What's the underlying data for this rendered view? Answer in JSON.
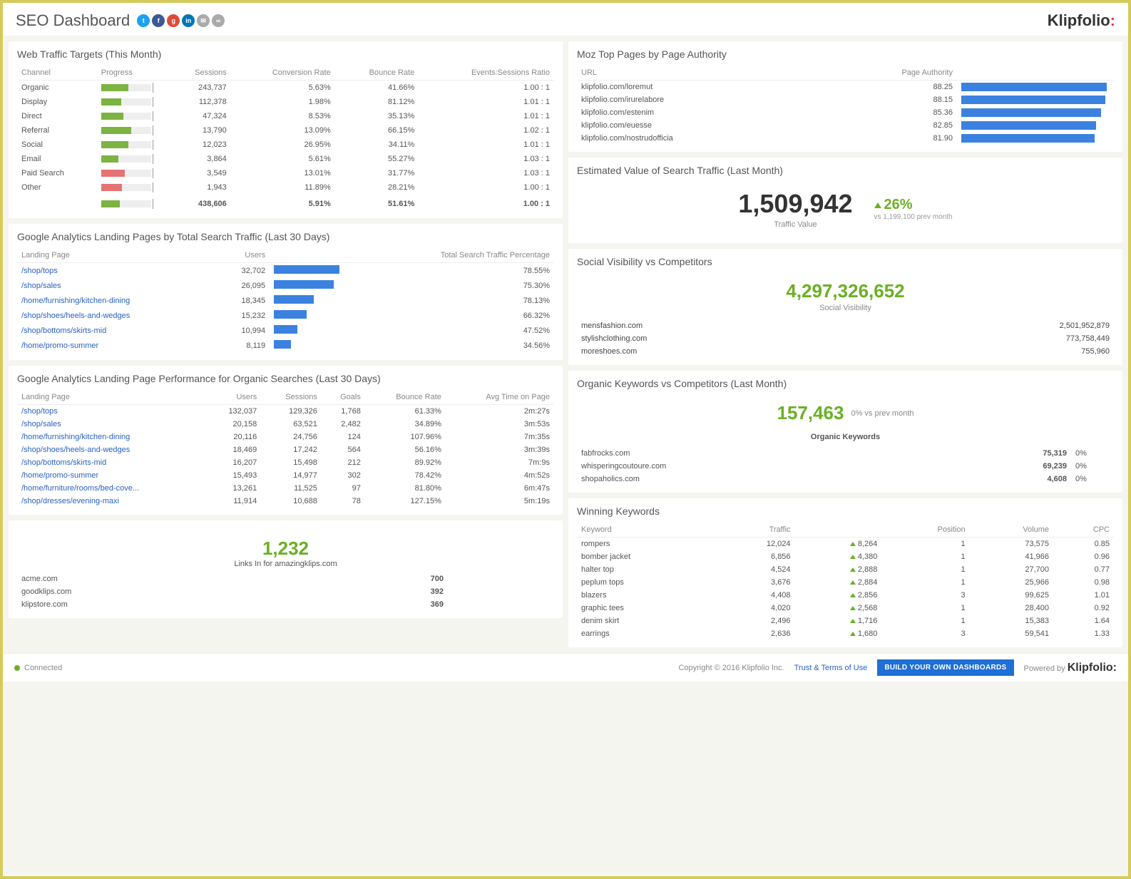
{
  "header": {
    "title": "SEO Dashboard",
    "brand": "Klipfolio",
    "social": [
      "twitter",
      "facebook",
      "gplus",
      "linkedin",
      "mail",
      "link"
    ]
  },
  "trafficTargets": {
    "title": "Web Traffic Targets (This Month)",
    "headers": [
      "Channel",
      "Progress",
      "Sessions",
      "Conversion Rate",
      "Bounce Rate",
      "Events:Sessions Ratio"
    ],
    "rows": [
      {
        "channel": "Organic",
        "progress": 55,
        "color": "#7cb342",
        "sessions": "243,737",
        "conv": "5.63%",
        "bounce": "41.66%",
        "ratio": "1.00 : 1"
      },
      {
        "channel": "Display",
        "progress": 40,
        "color": "#7cb342",
        "sessions": "112,378",
        "conv": "1.98%",
        "bounce": "81.12%",
        "ratio": "1.01 : 1"
      },
      {
        "channel": "Direct",
        "progress": 45,
        "color": "#7cb342",
        "sessions": "47,324",
        "conv": "8.53%",
        "bounce": "35.13%",
        "ratio": "1.01 : 1"
      },
      {
        "channel": "Referral",
        "progress": 60,
        "color": "#7cb342",
        "sessions": "13,790",
        "conv": "13.09%",
        "bounce": "66.15%",
        "ratio": "1.02 : 1"
      },
      {
        "channel": "Social",
        "progress": 55,
        "color": "#7cb342",
        "sessions": "12,023",
        "conv": "26.95%",
        "bounce": "34.11%",
        "ratio": "1.01 : 1"
      },
      {
        "channel": "Email",
        "progress": 35,
        "color": "#7cb342",
        "sessions": "3,864",
        "conv": "5.61%",
        "bounce": "55.27%",
        "ratio": "1.03 : 1"
      },
      {
        "channel": "Paid Search",
        "progress": 48,
        "color": "#e57373",
        "sessions": "3,549",
        "conv": "13.01%",
        "bounce": "31.77%",
        "ratio": "1.03 : 1"
      },
      {
        "channel": "Other",
        "progress": 42,
        "color": "#e57373",
        "sessions": "1,943",
        "conv": "11.89%",
        "bounce": "28.21%",
        "ratio": "1.00 : 1"
      }
    ],
    "totals": {
      "progress": 38,
      "sessions": "438,606",
      "conv": "5.91%",
      "bounce": "51.61%",
      "ratio": "1.00 : 1"
    }
  },
  "landingPages": {
    "title": "Google Analytics Landing Pages by Total Search Traffic (Last 30 Days)",
    "headers": [
      "Landing Page",
      "Users",
      "",
      "Total Search Traffic Percentage"
    ],
    "rows": [
      {
        "page": "/shop/tops",
        "users": "32,702",
        "bar": 85,
        "pct": "78.55%"
      },
      {
        "page": "/shop/sales",
        "users": "26,095",
        "bar": 78,
        "pct": "75.30%"
      },
      {
        "page": "/home/furnishing/kitchen-dining",
        "users": "18,345",
        "bar": 52,
        "pct": "78.13%"
      },
      {
        "page": "/shop/shoes/heels-and-wedges",
        "users": "15,232",
        "bar": 42,
        "pct": "66.32%"
      },
      {
        "page": "/shop/bottoms/skirts-mid",
        "users": "10,994",
        "bar": 30,
        "pct": "47.52%"
      },
      {
        "page": "/home/promo-summer",
        "users": "8,119",
        "bar": 22,
        "pct": "34.56%"
      }
    ]
  },
  "landingPerf": {
    "title": "Google Analytics Landing Page Performance for Organic Searches (Last 30 Days)",
    "headers": [
      "Landing Page",
      "Users",
      "Sessions",
      "Goals",
      "Bounce Rate",
      "Avg Time on Page"
    ],
    "rows": [
      {
        "page": "/shop/tops",
        "users": "132,037",
        "sessions": "129,326",
        "goals": "1,768",
        "bounce": "61.33%",
        "time": "2m:27s"
      },
      {
        "page": "/shop/sales",
        "users": "20,158",
        "sessions": "63,521",
        "goals": "2,482",
        "bounce": "34.89%",
        "time": "3m:53s"
      },
      {
        "page": "/home/furnishing/kitchen-dining",
        "users": "20,116",
        "sessions": "24,756",
        "goals": "124",
        "bounce": "107.96%",
        "time": "7m:35s"
      },
      {
        "page": "/shop/shoes/heels-and-wedges",
        "users": "18,469",
        "sessions": "17,242",
        "goals": "564",
        "bounce": "56.16%",
        "time": "3m:39s"
      },
      {
        "page": "/shop/bottoms/skirts-mid",
        "users": "16,207",
        "sessions": "15,498",
        "goals": "212",
        "bounce": "89.92%",
        "time": "7m:9s"
      },
      {
        "page": "/home/promo-summer",
        "users": "15,493",
        "sessions": "14,977",
        "goals": "302",
        "bounce": "78.42%",
        "time": "4m:52s"
      },
      {
        "page": "/home/furniture/rooms/bed-cove...",
        "users": "13,261",
        "sessions": "11,525",
        "goals": "97",
        "bounce": "81.80%",
        "time": "6m:47s"
      },
      {
        "page": "/shop/dresses/evening-maxi",
        "users": "11,914",
        "sessions": "10,688",
        "goals": "78",
        "bounce": "127.15%",
        "time": "5m:19s"
      }
    ]
  },
  "linksIn": {
    "value": "1,232",
    "label": "Links In for amazingklips.com",
    "rows": [
      {
        "site": "acme.com",
        "count": "700"
      },
      {
        "site": "goodklips.com",
        "count": "392"
      },
      {
        "site": "klipstore.com",
        "count": "369"
      }
    ]
  },
  "mozTop": {
    "title": "Moz Top Pages by Page Authority",
    "headers": [
      "URL",
      "Page Authority"
    ],
    "rows": [
      {
        "url": "klipfolio.com/loremut",
        "auth": "88.25",
        "bar": 98
      },
      {
        "url": "klipfolio.com/irurelabore",
        "auth": "88.15",
        "bar": 97
      },
      {
        "url": "klipfolio.com/estenim",
        "auth": "85.36",
        "bar": 94
      },
      {
        "url": "klipfolio.com/euesse",
        "auth": "82.85",
        "bar": 91
      },
      {
        "url": "klipfolio.com/nostrudofficia",
        "auth": "81.90",
        "bar": 90
      }
    ]
  },
  "estValue": {
    "title": "Estimated Value of Search Traffic (Last Month)",
    "value": "1,509,942",
    "label": "Traffic Value",
    "delta": "26%",
    "deltaSub": "vs 1,199,100 prev month"
  },
  "socialVis": {
    "title": "Social Visibility vs Competitors",
    "value": "4,297,326,652",
    "label": "Social Visibility",
    "rows": [
      {
        "site": "mensfashion.com",
        "val": "2,501,952,879"
      },
      {
        "site": "stylishclothing.com",
        "val": "773,758,449"
      },
      {
        "site": "moreshoes.com",
        "val": "755,960"
      }
    ]
  },
  "orgKeywords": {
    "title": "Organic Keywords vs Competitors (Last Month)",
    "value": "157,463",
    "delta": "0% vs prev month",
    "label": "Organic Keywords",
    "rows": [
      {
        "site": "fabfrocks.com",
        "val": "75,319",
        "pct": "0%"
      },
      {
        "site": "whisperingcoutoure.com",
        "val": "69,239",
        "pct": "0%"
      },
      {
        "site": "shopaholics.com",
        "val": "4,608",
        "pct": "0%"
      }
    ]
  },
  "winning": {
    "title": "Winning Keywords",
    "headers": [
      "Keyword",
      "Traffic",
      "",
      "Position",
      "Volume",
      "CPC"
    ],
    "rows": [
      {
        "kw": "rompers",
        "traffic": "12,024",
        "delta": "8,264",
        "pos": "1",
        "vol": "73,575",
        "cpc": "0.85"
      },
      {
        "kw": "bomber jacket",
        "traffic": "6,856",
        "delta": "4,380",
        "pos": "1",
        "vol": "41,966",
        "cpc": "0.96"
      },
      {
        "kw": "halter top",
        "traffic": "4,524",
        "delta": "2,888",
        "pos": "1",
        "vol": "27,700",
        "cpc": "0.77"
      },
      {
        "kw": "peplum tops",
        "traffic": "3,676",
        "delta": "2,884",
        "pos": "1",
        "vol": "25,966",
        "cpc": "0.98"
      },
      {
        "kw": "blazers",
        "traffic": "4,408",
        "delta": "2,856",
        "pos": "3",
        "vol": "99,625",
        "cpc": "1.01"
      },
      {
        "kw": "graphic tees",
        "traffic": "4,020",
        "delta": "2,568",
        "pos": "1",
        "vol": "28,400",
        "cpc": "0.92"
      },
      {
        "kw": "denim skirt",
        "traffic": "2,496",
        "delta": "1,716",
        "pos": "1",
        "vol": "15,383",
        "cpc": "1.64"
      },
      {
        "kw": "earrings",
        "traffic": "2,636",
        "delta": "1,680",
        "pos": "3",
        "vol": "59,541",
        "cpc": "1.33"
      }
    ]
  },
  "footer": {
    "status": "Connected",
    "copyright": "Copyright © 2016 Klipfolio Inc.",
    "terms": "Trust & Terms of Use",
    "button": "BUILD YOUR OWN DASHBOARDS",
    "powered": "Powered by"
  }
}
